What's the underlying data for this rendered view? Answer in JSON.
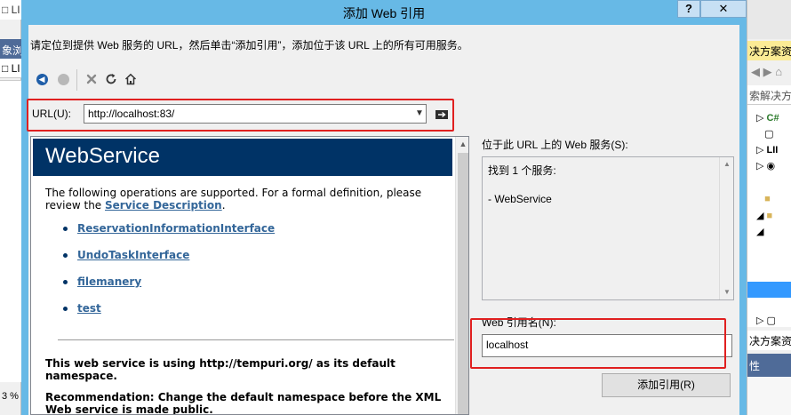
{
  "background": {
    "left": {
      "item1": "□ LI",
      "tab": "象浏",
      "item2": "□ LI",
      "zoom": "3 %"
    },
    "right": {
      "header": "决方案资",
      "search": "索解决方",
      "tree_nodes": [
        "C#",
        "",
        "LII",
        "",
        "",
        "",
        "",
        ""
      ],
      "header2": "决方案资",
      "properties": "性"
    }
  },
  "dialog": {
    "title": "添加 Web 引用",
    "help_glyph": "?",
    "close_glyph": "✕",
    "instruction": "请定位到提供 Web 服务的 URL，然后单击“添加引用”，添加位于该 URL 上的所有可用服务。",
    "url_label": "URL(U):",
    "url_value": "http://localhost:83/",
    "browser": {
      "header": "WebService",
      "intro_text": "The following operations are supported. For a formal definition, please review the ",
      "intro_link": "Service Description",
      "intro_end": ".",
      "operations": [
        "ReservationInformationInterface",
        "UndoTaskInterface",
        "filemanery",
        "test"
      ],
      "note1": "This web service is using http://tempuri.org/ as its default namespace.",
      "note2": "Recommendation: Change the default namespace before the XML Web service is made public."
    },
    "services_label": "位于此 URL 上的 Web 服务(S):",
    "services_found": "找到 1 个服务:",
    "services_item": "- WebService",
    "refname_label": "Web 引用名(N):",
    "refname_value": "localhost",
    "add_ref_button": "添加引用(R)"
  },
  "icons": {
    "back": "back-arrow-icon",
    "forward": "forward-circle-icon",
    "stop": "stop-x-icon",
    "refresh": "refresh-icon",
    "home": "home-icon",
    "go": "go-arrow-icon"
  },
  "colors": {
    "title_bar": "#67b9e6",
    "ws_header": "#003366",
    "link": "#336699",
    "highlight": "#e02020"
  }
}
